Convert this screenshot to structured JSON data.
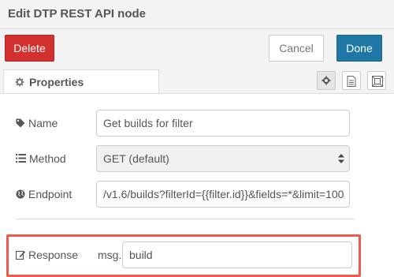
{
  "tray": {
    "title": "Edit DTP REST API node"
  },
  "toolbar": {
    "delete_label": "Delete",
    "cancel_label": "Cancel",
    "done_label": "Done"
  },
  "tabs": [
    {
      "label": "Properties",
      "icon": "gear-icon"
    }
  ],
  "tab_tools": [
    {
      "icon": "gear-icon"
    },
    {
      "icon": "document-icon"
    },
    {
      "icon": "frame-icon"
    }
  ],
  "form": {
    "name": {
      "label": "Name",
      "icon": "tag-icon",
      "value": "Get builds for filter"
    },
    "method": {
      "label": "Method",
      "icon": "list-icon",
      "value": "GET (default)"
    },
    "endpoint": {
      "label": "Endpoint",
      "icon": "globe-icon",
      "value": "/v1.6/builds?filterId={{filter.id}}&fields=*&limit=100"
    },
    "response": {
      "label": "Response",
      "icon": "edit-icon",
      "prefix": "msg.",
      "value": "build"
    }
  },
  "colors": {
    "delete": "#d33030",
    "done": "#1f77a6",
    "highlight": "#ee5a4e"
  }
}
